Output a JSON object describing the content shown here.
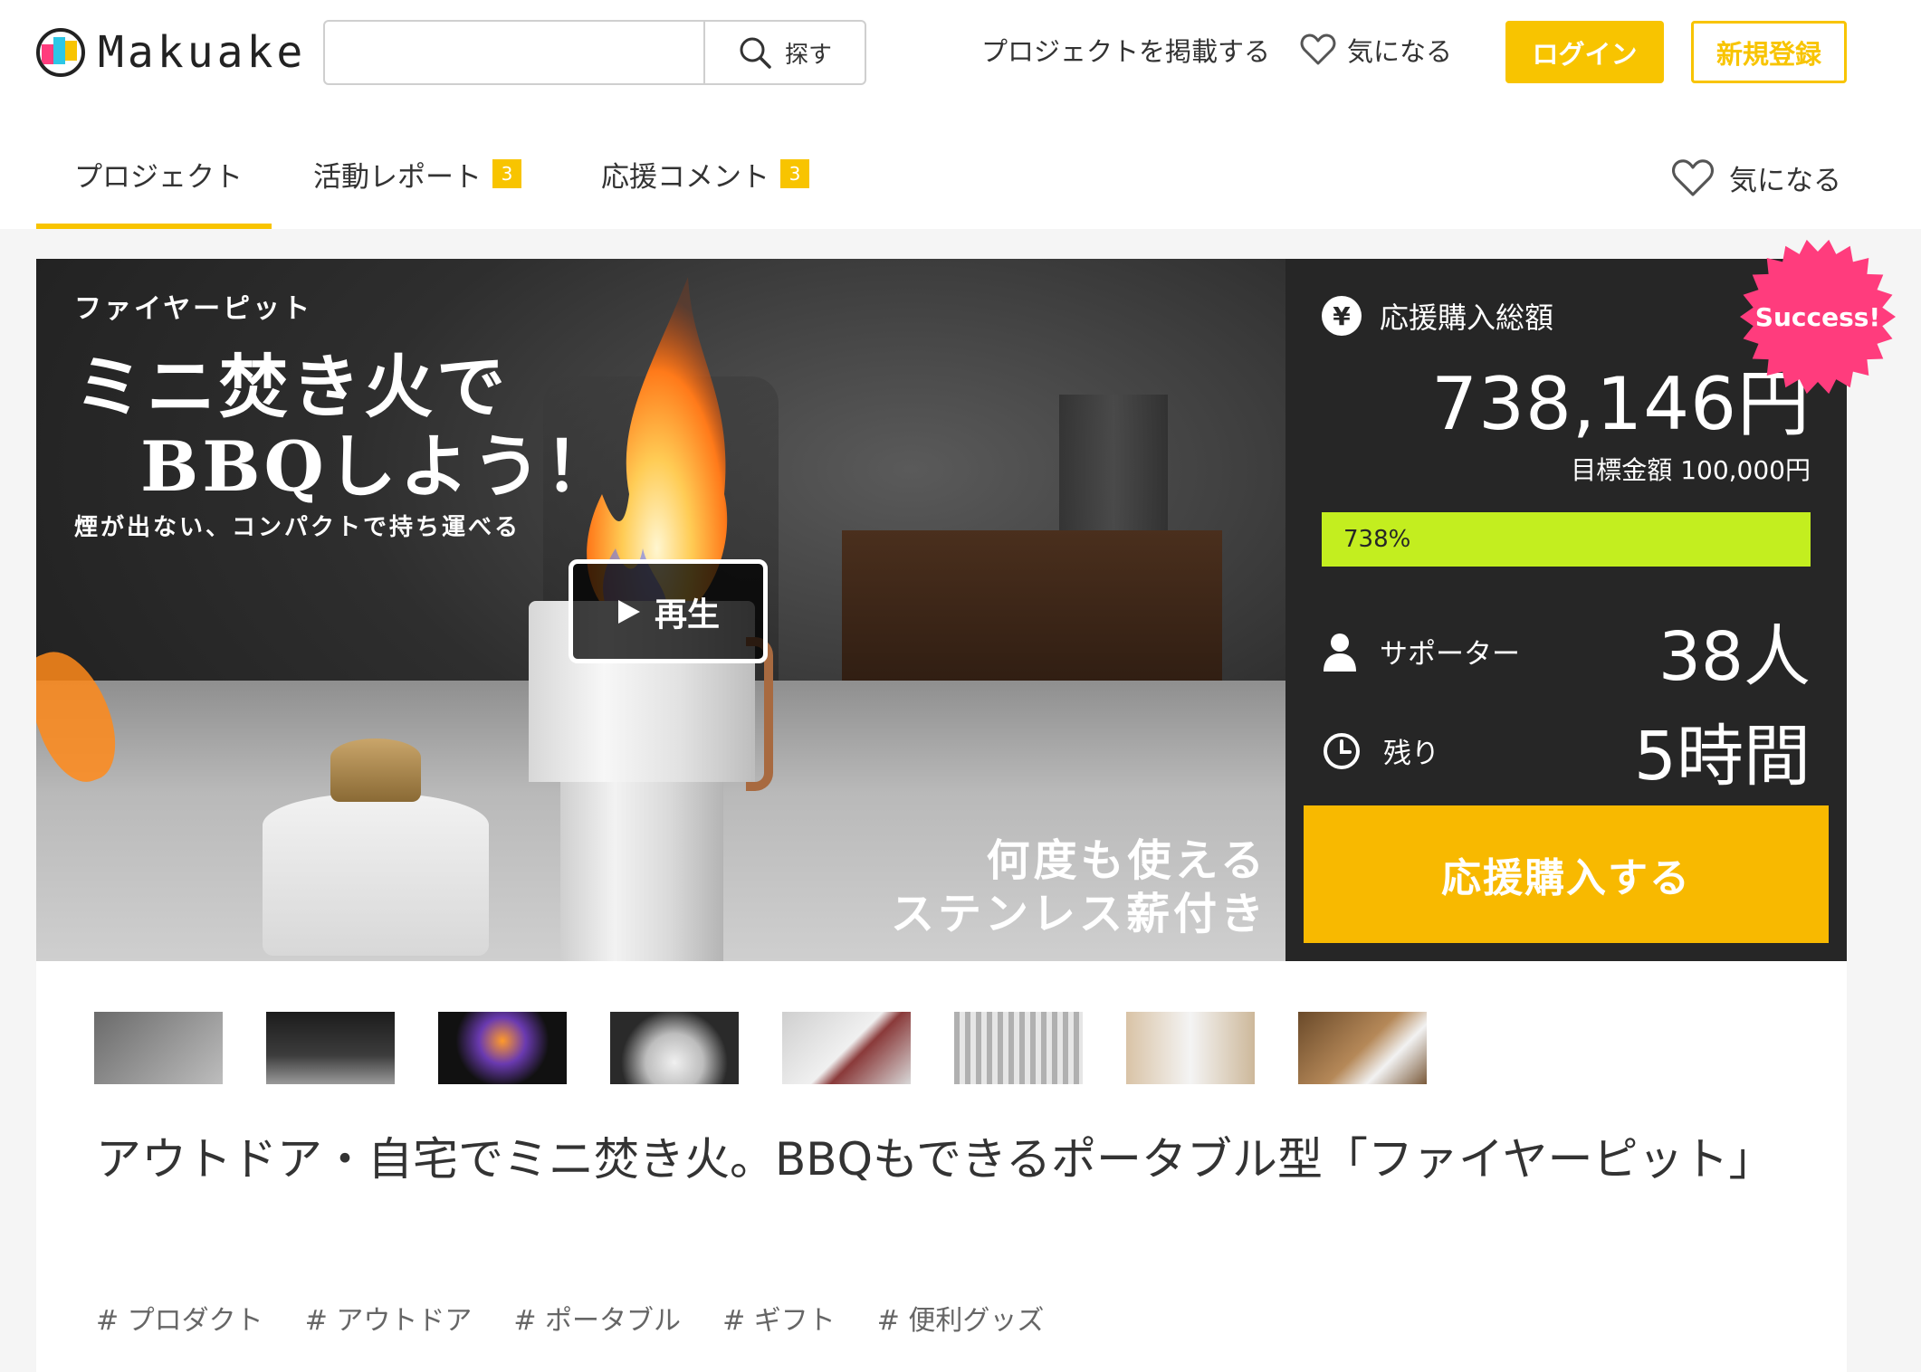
{
  "brand": {
    "name": "Makuake"
  },
  "search": {
    "placeholder": "",
    "button_label": "探す"
  },
  "header": {
    "post_project": "プロジェクトを掲載する",
    "favorite": "気になる",
    "login": "ログイン",
    "signup": "新規登録"
  },
  "tabs": [
    {
      "label": "プロジェクト",
      "badge": ""
    },
    {
      "label": "活動レポート",
      "badge": "3"
    },
    {
      "label": "応援コメント",
      "badge": "3"
    }
  ],
  "tabs_favorite": "気になる",
  "hero": {
    "subtitle": "ファイヤーピット",
    "title_line1": "ミニ焚き火で",
    "title_line2": "BBQしよう！",
    "tagline": "煙が出ない、コンパクトで持ち運べる",
    "caption_line1": "何度も使える",
    "caption_line2": "ステンレス薪付き",
    "play_label": "再生"
  },
  "stats": {
    "total_label": "応援購入総額",
    "total_amount": "738,146円",
    "goal_text": "目標金額 100,000円",
    "progress_text": "738%",
    "progress_fraction": 1.0,
    "supporters_label": "サポーター",
    "supporters_value": "38人",
    "remaining_label": "残り",
    "remaining_value": "5時間",
    "cta_label": "応援購入する",
    "success_badge": "Success!"
  },
  "project": {
    "title": "アウトドア・自宅でミニ焚き火。BBQもできるポータブル型「ファイヤーピット」",
    "tags": [
      "# プロダクト",
      "# アウトドア",
      "# ポータブル",
      "# ギフト",
      "# 便利グッズ"
    ]
  },
  "colors": {
    "accent": "#f8c400",
    "progress": "#c3ee1f",
    "success": "#ff3c7d",
    "cta": "#f8b900"
  }
}
